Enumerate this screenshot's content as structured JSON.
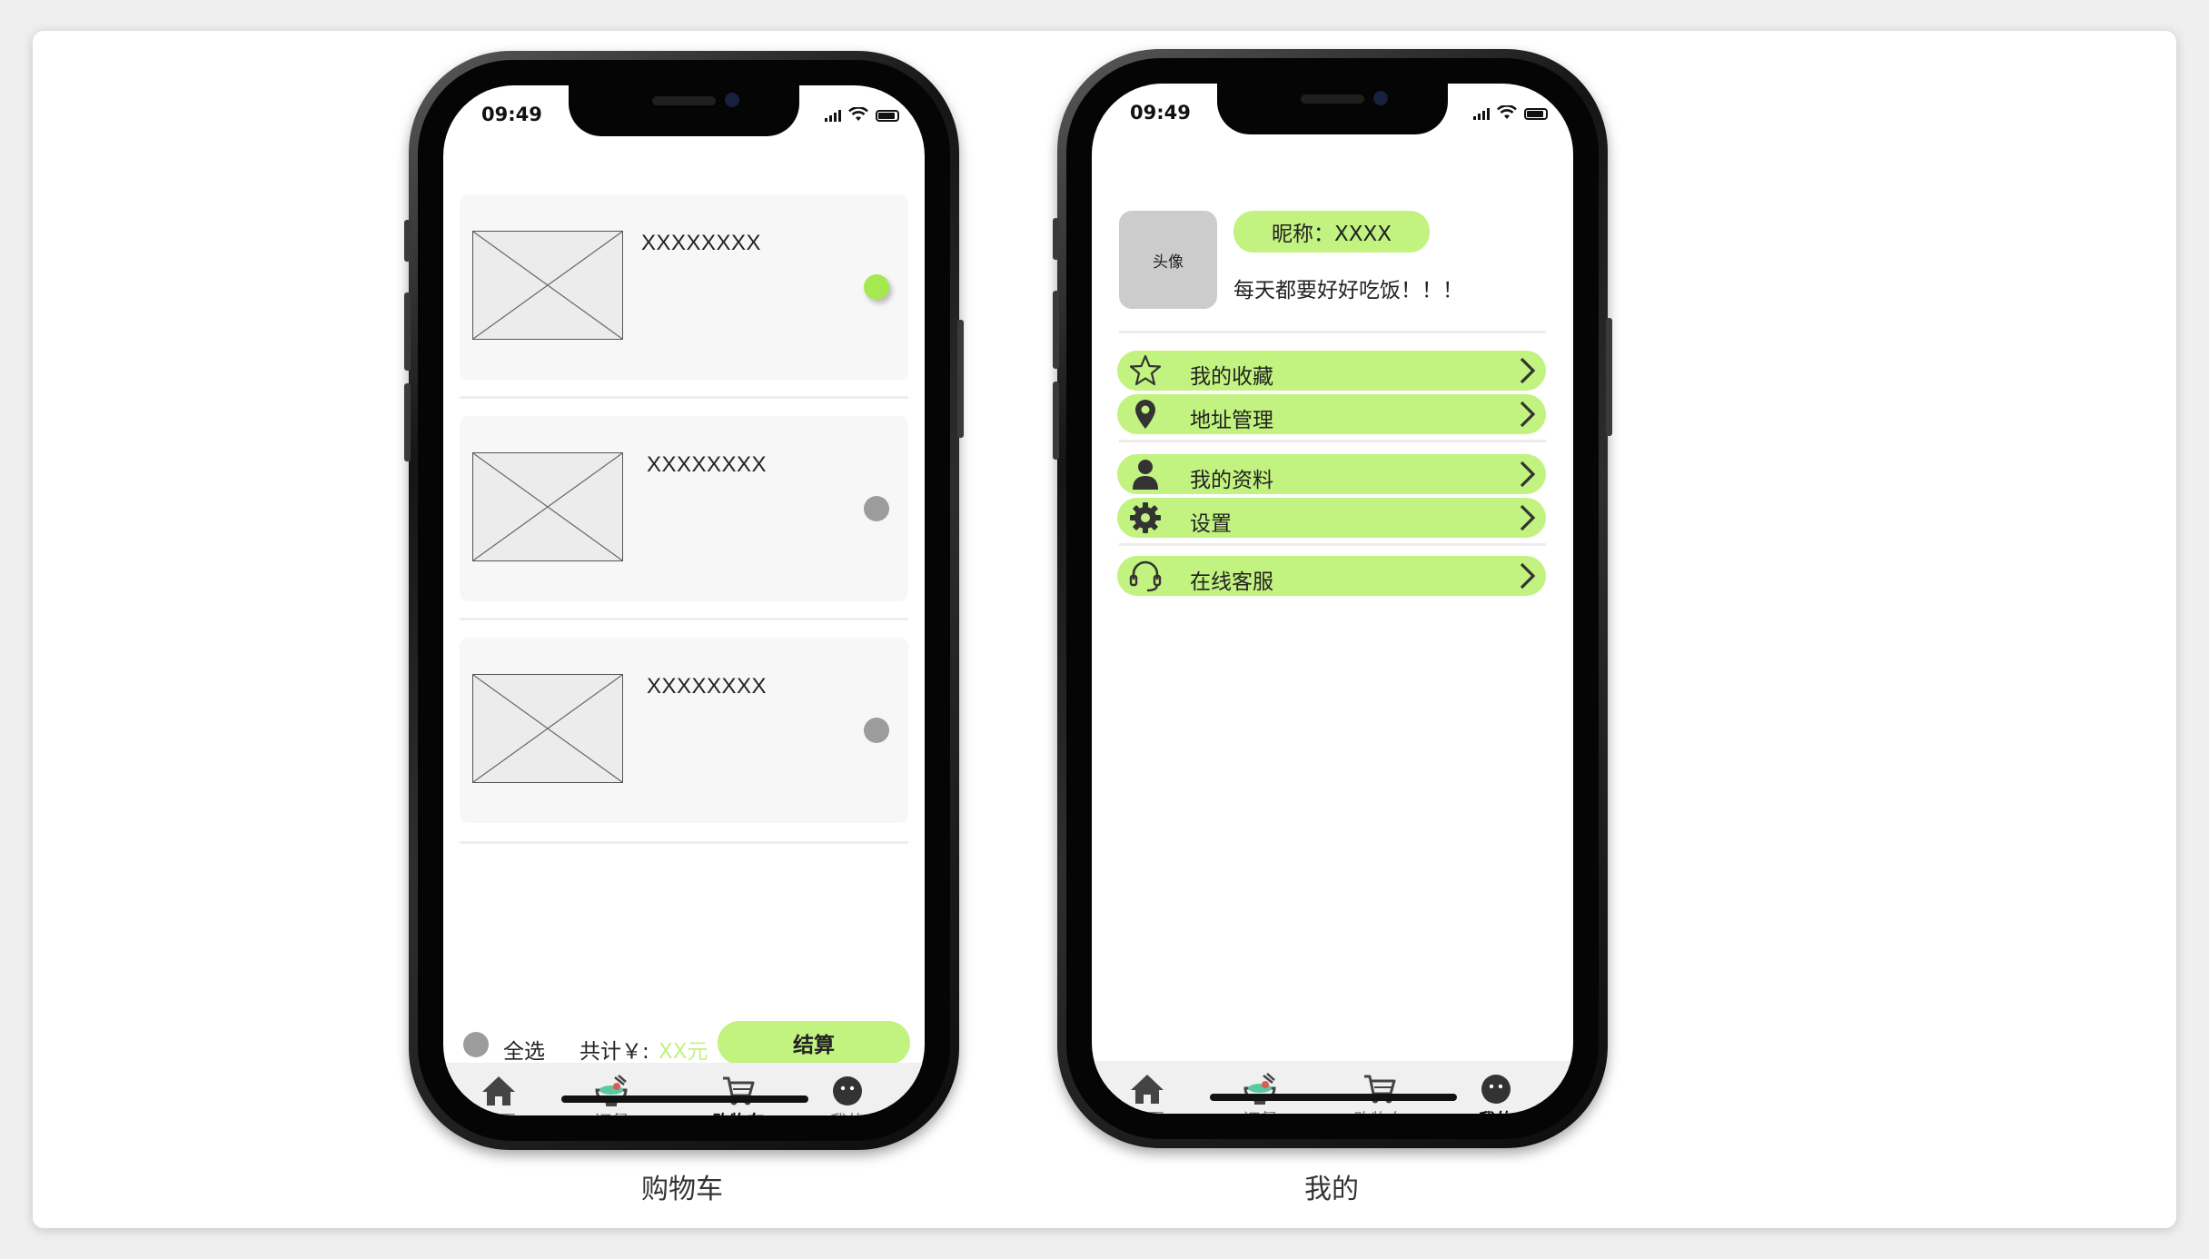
{
  "captions": {
    "left": "购物车",
    "right": "我的"
  },
  "status": {
    "time": "09:49"
  },
  "cart": {
    "items": [
      {
        "name": "XXXXXXXX",
        "selected": true
      },
      {
        "name": "XXXXXXXX",
        "selected": false
      },
      {
        "name": "XXXXXXXX",
        "selected": false
      }
    ],
    "footer": {
      "select_all": "全选",
      "total_label": "共计￥:",
      "total_value": "XX元",
      "checkout": "结算"
    }
  },
  "profile": {
    "avatar": "头像",
    "nickname": "昵称：XXXX",
    "motto": "每天都要好好吃饭！！！",
    "menu": [
      {
        "label": "我的收藏",
        "icon": "star-icon"
      },
      {
        "label": "地址管理",
        "icon": "location-pin-icon"
      },
      {
        "label": "我的资料",
        "icon": "person-icon"
      },
      {
        "label": "设置",
        "icon": "gear-icon"
      },
      {
        "label": "在线客服",
        "icon": "headset-icon"
      }
    ]
  },
  "tabs": [
    {
      "label": "首页",
      "icon": "home-icon"
    },
    {
      "label": "订餐",
      "icon": "food-bowl-icon"
    },
    {
      "label": "购物车",
      "icon": "cart-icon"
    },
    {
      "label": "我的",
      "icon": "user-circle-icon"
    }
  ],
  "active_tab": {
    "left_screen": "购物车",
    "right_screen": "我的"
  },
  "colors": {
    "accent": "#c2f27f",
    "radio_on": "#a5e850",
    "radio_off": "#9c9c9c"
  }
}
